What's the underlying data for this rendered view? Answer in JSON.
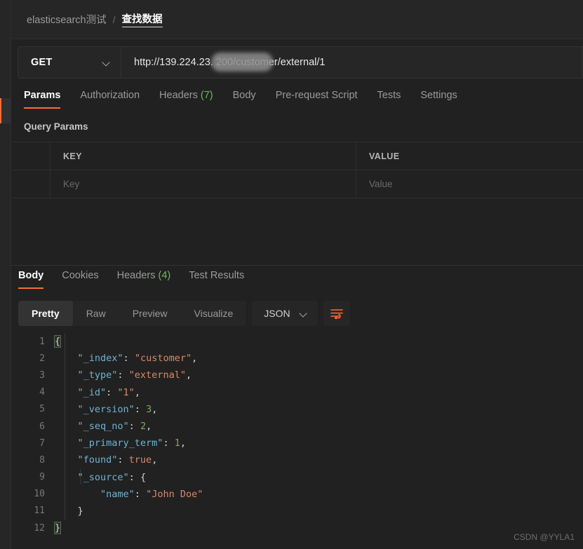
{
  "breadcrumb": {
    "collection": "elasticsearch测试",
    "separator": "/",
    "current": "查找数据"
  },
  "request": {
    "method": "GET",
    "method_dropdown_icon": "chevron-down-icon",
    "url": "http://139.224.23.               200/customer/external/1",
    "url_visible_prefix": "http://139.224.23.",
    "url_visible_suffix": "200/customer/external/1",
    "url_redacted": true,
    "tabs": [
      {
        "label": "Params",
        "count": "",
        "active": true
      },
      {
        "label": "Authorization",
        "count": "",
        "active": false
      },
      {
        "label": "Headers",
        "count": "(7)",
        "active": false
      },
      {
        "label": "Body",
        "count": "",
        "active": false
      },
      {
        "label": "Pre-request Script",
        "count": "",
        "active": false
      },
      {
        "label": "Tests",
        "count": "",
        "active": false
      },
      {
        "label": "Settings",
        "count": "",
        "active": false
      }
    ],
    "query_params": {
      "title": "Query Params",
      "columns": [
        "KEY",
        "VALUE"
      ],
      "rows": [
        {
          "key_placeholder": "Key",
          "value_placeholder": "Value"
        }
      ]
    }
  },
  "response": {
    "tabs": [
      {
        "label": "Body",
        "count": "",
        "active": true
      },
      {
        "label": "Cookies",
        "count": "",
        "active": false
      },
      {
        "label": "Headers",
        "count": "(4)",
        "active": false
      },
      {
        "label": "Test Results",
        "count": "",
        "active": false
      }
    ],
    "view_modes": [
      {
        "label": "Pretty",
        "active": true
      },
      {
        "label": "Raw",
        "active": false
      },
      {
        "label": "Preview",
        "active": false
      },
      {
        "label": "Visualize",
        "active": false
      }
    ],
    "format": "JSON",
    "format_dropdown_icon": "chevron-down-icon",
    "wrap_button_icon": "word-wrap-icon",
    "body_lines": [
      {
        "num": "1",
        "segments": [
          {
            "t": "{",
            "c": "brace"
          }
        ]
      },
      {
        "num": "2",
        "segments": [
          {
            "t": "    \"_index\"",
            "c": "k"
          },
          {
            "t": ": ",
            "c": "p"
          },
          {
            "t": "\"customer\"",
            "c": "s"
          },
          {
            "t": ",",
            "c": "p"
          }
        ]
      },
      {
        "num": "3",
        "segments": [
          {
            "t": "    \"_type\"",
            "c": "k"
          },
          {
            "t": ": ",
            "c": "p"
          },
          {
            "t": "\"external\"",
            "c": "s"
          },
          {
            "t": ",",
            "c": "p"
          }
        ]
      },
      {
        "num": "4",
        "segments": [
          {
            "t": "    \"_id\"",
            "c": "k"
          },
          {
            "t": ": ",
            "c": "p"
          },
          {
            "t": "\"1\"",
            "c": "s"
          },
          {
            "t": ",",
            "c": "p"
          }
        ]
      },
      {
        "num": "5",
        "segments": [
          {
            "t": "    \"_version\"",
            "c": "k"
          },
          {
            "t": ": ",
            "c": "p"
          },
          {
            "t": "3",
            "c": "n"
          },
          {
            "t": ",",
            "c": "p"
          }
        ]
      },
      {
        "num": "6",
        "segments": [
          {
            "t": "    \"_seq_no\"",
            "c": "k"
          },
          {
            "t": ": ",
            "c": "p"
          },
          {
            "t": "2",
            "c": "n"
          },
          {
            "t": ",",
            "c": "p"
          }
        ]
      },
      {
        "num": "7",
        "segments": [
          {
            "t": "    \"_primary_term\"",
            "c": "k"
          },
          {
            "t": ": ",
            "c": "p"
          },
          {
            "t": "1",
            "c": "n"
          },
          {
            "t": ",",
            "c": "p"
          }
        ]
      },
      {
        "num": "8",
        "segments": [
          {
            "t": "    \"found\"",
            "c": "k"
          },
          {
            "t": ": ",
            "c": "p"
          },
          {
            "t": "true",
            "c": "s"
          },
          {
            "t": ",",
            "c": "p"
          }
        ]
      },
      {
        "num": "9",
        "segments": [
          {
            "t": "    \"_source\"",
            "c": "k"
          },
          {
            "t": ": ",
            "c": "p"
          },
          {
            "t": "{",
            "c": "p"
          }
        ]
      },
      {
        "num": "10",
        "segments": [
          {
            "t": "        \"name\"",
            "c": "k"
          },
          {
            "t": ": ",
            "c": "p"
          },
          {
            "t": "\"John Doe\"",
            "c": "s"
          }
        ]
      },
      {
        "num": "11",
        "segments": [
          {
            "t": "    }",
            "c": "p"
          }
        ]
      },
      {
        "num": "12",
        "segments": [
          {
            "t": "}",
            "c": "brace"
          }
        ]
      }
    ]
  },
  "watermark": "CSDN @YYLA1",
  "colors": {
    "accent": "#ff6c37",
    "count_green": "#6bbf59",
    "json_key": "#6fb3d2",
    "json_string": "#d88a6a",
    "json_number": "#7cab5c",
    "background": "#212121",
    "panel": "#262626"
  }
}
